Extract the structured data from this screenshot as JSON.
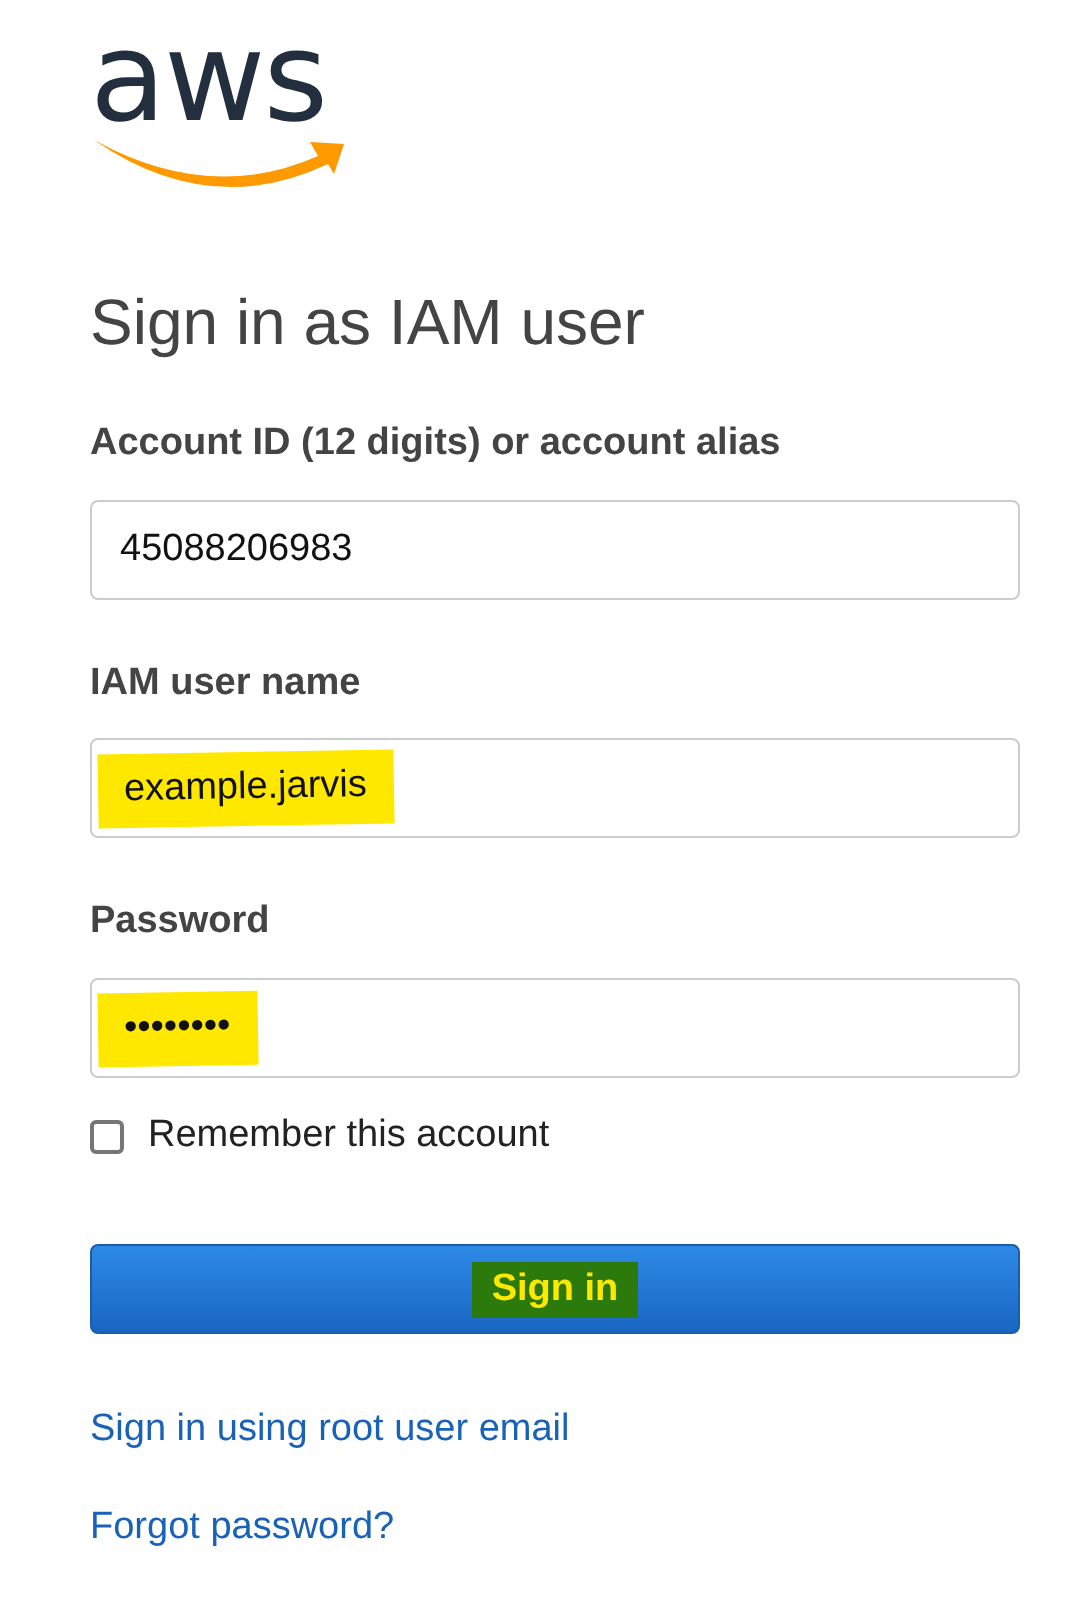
{
  "logo": {
    "text": "aws"
  },
  "heading": "Sign in as IAM user",
  "fields": [
    {
      "label": "Account ID (12 digits) or account alias",
      "value": "45088206983",
      "highlighted": false
    },
    {
      "label": "IAM user name",
      "value": "example.jarvis",
      "highlighted": true
    },
    {
      "label": "Password",
      "value": "••••••••",
      "highlighted": true
    }
  ],
  "remember": {
    "label": "Remember this account",
    "checked": false
  },
  "sign_in_button": {
    "label": "Sign in",
    "highlighted": true
  },
  "links": [
    "Sign in using root user email",
    "Forgot password?"
  ]
}
